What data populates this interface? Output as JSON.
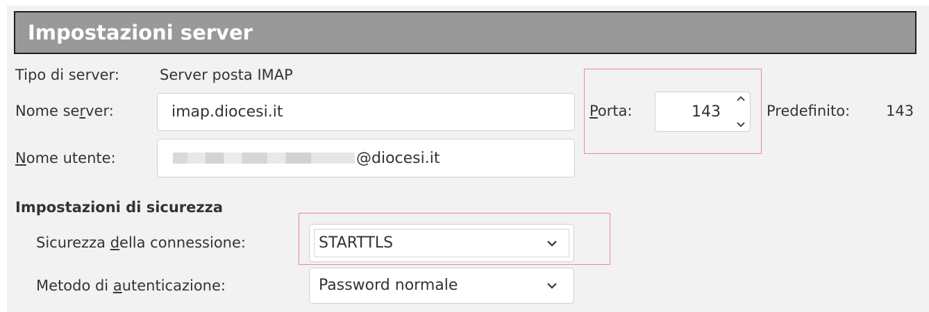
{
  "header": {
    "title": "Impostazioni server"
  },
  "server": {
    "type_label": "Tipo di server:",
    "type_value": "Server posta IMAP",
    "name_label_pre": "Nome se",
    "name_label_u": "r",
    "name_label_post": "ver:",
    "name_value": "imap.diocesi.it",
    "port_label_u": "P",
    "port_label_post": "orta:",
    "port_value": "143",
    "default_label": "Predefinito:",
    "default_value": "143",
    "user_label_u": "N",
    "user_label_post": "ome utente:",
    "user_value_suffix": "@diocesi.it"
  },
  "security": {
    "section_title": "Impostazioni di sicurezza",
    "conn_label_pre": "Sicurezza ",
    "conn_label_u": "d",
    "conn_label_post": "ella connessione:",
    "conn_value": "STARTTLS",
    "auth_label_pre": "Metodo di ",
    "auth_label_u": "a",
    "auth_label_post": "utenticazione:",
    "auth_value": "Password normale"
  },
  "colors": {
    "header_bg": "#999999",
    "highlight": "#e58b8b",
    "panel_bg": "#f2f2f2"
  },
  "icons": [
    "chevron-up-icon",
    "chevron-down-icon",
    "dropdown-chevron-icon"
  ]
}
